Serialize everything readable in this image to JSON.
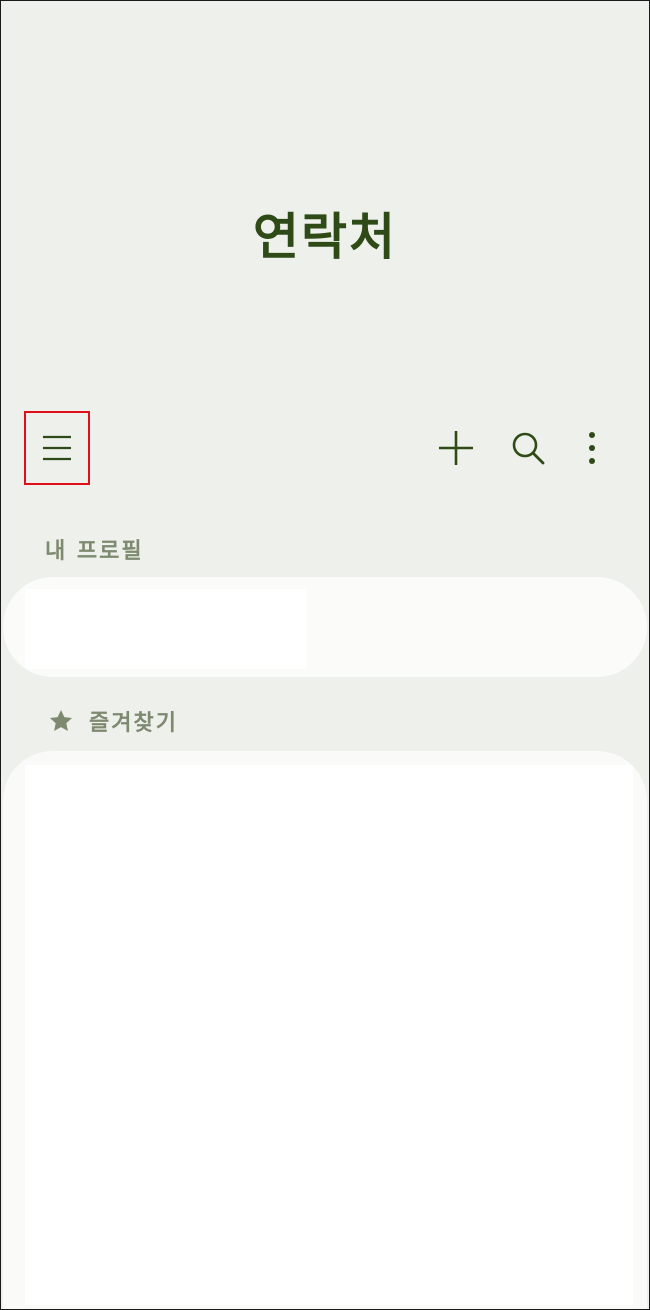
{
  "app": {
    "title": "연락처"
  },
  "toolbar": {
    "menu_icon": "hamburger-menu-icon",
    "add_icon": "plus-icon",
    "search_icon": "search-icon",
    "more_icon": "more-vertical-icon"
  },
  "sections": {
    "profile_label": "내 프로필",
    "favorites_label": "즐겨찾기",
    "favorites_icon": "star-icon"
  },
  "colors": {
    "background": "#eef0eb",
    "title": "#2e4a17",
    "icon": "#2e4a17",
    "section_label": "#7e8a6f",
    "highlight": "#e0101a"
  }
}
